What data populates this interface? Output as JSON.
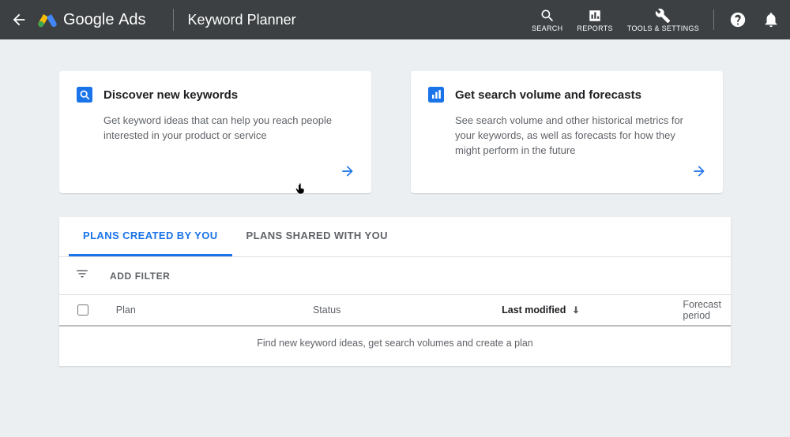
{
  "header": {
    "brand_main": "Google",
    "brand_sub": "Ads",
    "page_title": "Keyword Planner",
    "nav": {
      "search": "SEARCH",
      "reports": "REPORTS",
      "tools": "TOOLS & SETTINGS"
    }
  },
  "cards": {
    "discover": {
      "title": "Discover new keywords",
      "desc": "Get keyword ideas that can help you reach people interested in your product or service"
    },
    "volume": {
      "title": "Get search volume and forecasts",
      "desc": "See search volume and other historical metrics for your keywords, as well as forecasts for how they might perform in the future"
    }
  },
  "tabs": {
    "created": "PLANS CREATED BY YOU",
    "shared": "PLANS SHARED WITH YOU"
  },
  "filter": {
    "add": "ADD FILTER"
  },
  "table": {
    "plan": "Plan",
    "status": "Status",
    "lastmod": "Last modified",
    "forecast": "Forecast period",
    "empty": "Find new keyword ideas, get search volumes and create a plan"
  },
  "colors": {
    "accent": "#1a73e8"
  }
}
